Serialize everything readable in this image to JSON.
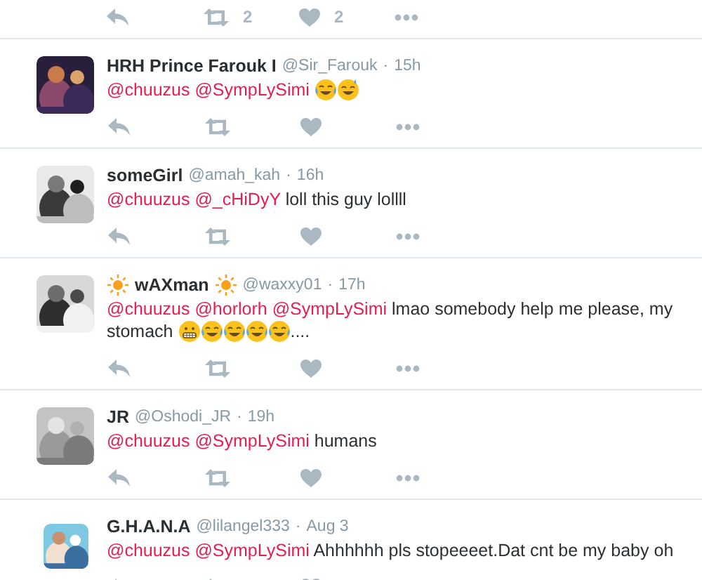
{
  "partial_tweet": {
    "actions": {
      "retweet_count": "2",
      "like_count": "2"
    }
  },
  "tweets": [
    {
      "name": "HRH Prince Farouk I",
      "handle": "@Sir_Farouk",
      "dot": "·",
      "time": "15h",
      "avatar": {
        "kind": "picture"
      },
      "body": [
        {
          "kind": "mention",
          "text": "@chuuzus"
        },
        {
          "kind": "mention",
          "text": "@SympLySimi"
        },
        {
          "kind": "joy-emoji"
        },
        {
          "kind": "sweat-smile-emoji"
        }
      ]
    },
    {
      "name": "someGirl",
      "handle": "@amah_kah",
      "dot": "·",
      "time": "16h",
      "avatar": {
        "kind": "picture"
      },
      "body": [
        {
          "kind": "mention",
          "text": "@chuuzus"
        },
        {
          "kind": "mention",
          "text": "@_cHiDyY"
        },
        {
          "kind": "text",
          "text": "loll this guy lollll"
        }
      ]
    },
    {
      "name": "wAXman",
      "name_decoration": {
        "kind": "sun"
      },
      "handle": "@waxxy01",
      "dot": "·",
      "time": "17h",
      "avatar": {
        "kind": "picture"
      },
      "body": [
        {
          "kind": "mention",
          "text": "@chuuzus"
        },
        {
          "kind": "mention",
          "text": "@horlorh"
        },
        {
          "kind": "mention",
          "text": "@SympLySimi"
        },
        {
          "kind": "text",
          "text": "lmao somebody help me please, my stomach"
        },
        {
          "kind": "grimace-emoji"
        },
        {
          "kind": "joy-emoji"
        },
        {
          "kind": "joy-emoji"
        },
        {
          "kind": "joy-emoji"
        },
        {
          "kind": "joy-emoji"
        },
        {
          "kind": "suffix",
          "text": "...."
        }
      ]
    },
    {
      "name": "JR",
      "handle": "@Oshodi_JR",
      "dot": "·",
      "time": "19h",
      "avatar": {
        "kind": "picture"
      },
      "body": [
        {
          "kind": "mention",
          "text": "@chuuzus"
        },
        {
          "kind": "mention",
          "text": "@SympLySimi"
        },
        {
          "kind": "text",
          "text": "humans"
        }
      ]
    },
    {
      "name": "G.H.A.N.A",
      "handle": "@lilangel333",
      "dot": "·",
      "time": "Aug 3",
      "avatar": {
        "kind": "picture"
      },
      "body": [
        {
          "kind": "mention",
          "text": "@chuuzus"
        },
        {
          "kind": "mention",
          "text": "@SympLySimi"
        },
        {
          "kind": "text",
          "text": "Ahhhhhh pls stopeeeet.Dat cnt be my baby oh"
        }
      ]
    }
  ]
}
